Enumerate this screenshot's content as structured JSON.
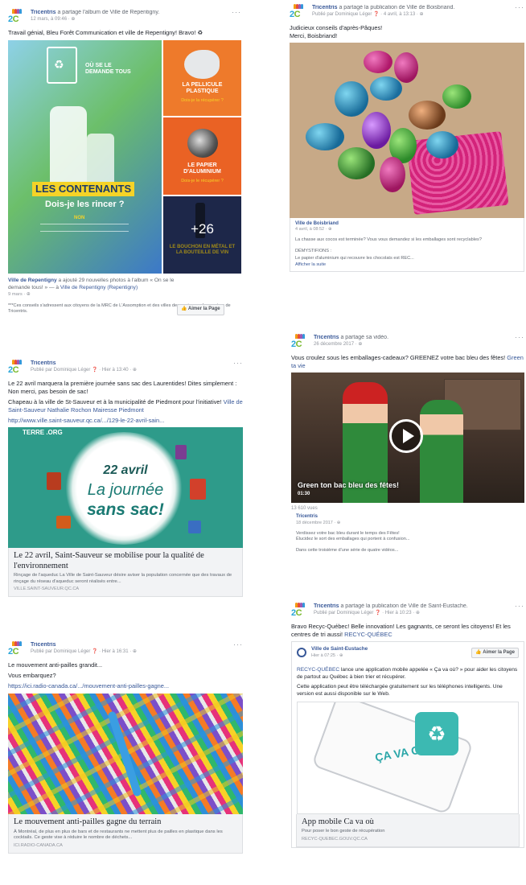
{
  "colors": {
    "link": "#385898",
    "green_bg": "#2e9b8a",
    "elf_green": "#2f8a3b"
  },
  "post1": {
    "author": "Tricentris",
    "action": "a partagé l'album de Ville de Repentigny.",
    "time": "12 mars, à 09:46 · ",
    "more": "···",
    "text": "Travail génial, Bleu Forêt Communication et ville de Repentigny! Bravo! ♻",
    "tile_main_top": "OÙ SE LE DEMANDE TOUS",
    "tile_main_title": "LES CONTENANTS",
    "tile_main_sub": "Dois-je les rincer ?",
    "tile_main_non": "NON",
    "tile_a_title": "LA PELLICULE PLASTIQUE",
    "tile_a_sub": "Dois-je la récupérer ?",
    "tile_b_title": "LE PAPIER D'ALUMINIUM",
    "tile_b_sub": "Dois-je le récupérer ?",
    "tile_c_title": "LE BOUCHON EN MÉTAL ET LA BOUTEILLE DE VIN",
    "plus": "+26",
    "footer_name": "Ville de Repentigny",
    "footer_text": " a ajouté 29 nouvelles photos à l'album « On se le demande tous! » — à ",
    "footer_loc": "Ville de Repentigny (Repentigny)",
    "footer_time": "9 mars · ",
    "like_page": "👍 Aimer la Page",
    "note": "***Ces conseils s'adressent aux citoyens de la MRC de L'Assomption et des villes desservies par les centres de Tricentris."
  },
  "post2": {
    "author": "Tricentris",
    "action": "a partagé la publication de Ville de Boisbriand.",
    "time": "Publié par Dominique Léger ❓ · 4 avril, à 13:13 · ",
    "more": "···",
    "text": "Judicieux conseils d'après-Pâques!\nMerci, Boisbriand!",
    "shared_name": "Ville de Boisbriand",
    "shared_time": "4 avril, à 08:52 · ",
    "shared_text": "La chasse aux cocos est terminée? Vous vous demandez si les emballages sont recyclables?",
    "shared_tag": "DÉMYSTIFIONS :",
    "shared_text2": "Le papier d'aluminium qui recouvre les chocolats est REC...",
    "shared_more": "Afficher la suite"
  },
  "post3": {
    "author": "Tricentris",
    "time": "Publié par Dominique Léger ❓ · Hier à 13:40 · ",
    "more": "···",
    "text1": "Le 22 avril marquera la première journée sans sac des Laurentides! Dites simplement : Non merci, pas besoin de sac!",
    "text2a": "Chapeau à la ville de St-Sauveur et à la municipalité de Piedmont pour l'initiative! ",
    "text2b": "Ville de Saint-Sauveur Nathalie Rochon Mairesse Piedmont",
    "url": "http://www.ville.saint-sauveur.qc.ca/.../129-le-22-avril-sain...",
    "img_brand": "TERRE .ORG",
    "img_date": "22 avril",
    "img_line1": "La journée",
    "img_line2": "sans sac!",
    "cap_title": "Le 22 avril, Saint-Sauveur se mobilise pour la qualité de l'environnement",
    "cap_desc": "Rinçage de l'aqueduc La Ville de Saint-Sauveur désire aviser la population concernée que des travaux de rinçage du réseau d'aqueduc seront réalisés entre...",
    "cap_src": "VILLE.SAINT-SAUVEUR.QC.CA"
  },
  "post4": {
    "author": "Tricentris",
    "action": "a partagé sa vidéo.",
    "time": "26 décembre 2017 · ",
    "more": "···",
    "text_a": "Vous croulez sous les emballages-cadeaux? GREENEZ votre bac bleu des fêtes! ",
    "text_b": "Green ta vie",
    "video_title": "Green ton bac bleu des fêtes!",
    "video_time": "01:30",
    "views": "13 610 vues",
    "shared_name": "Tricentris",
    "shared_time": "18 décembre 2017 · ",
    "shared_text": "Verdissez votre bac bleu durant le temps des Fêtes!\nÉlucidez le sort des emballages qui portent à confusion...",
    "shared_text2": "Dans cette troisième d'une série de quatre vidéos..."
  },
  "post5": {
    "author": "Tricentris",
    "time": "Publié par Dominique Léger ❓ · Hier à 16:31 · ",
    "more": "···",
    "text1": "Le mouvement anti-pailles grandit...",
    "text2": "Vous embarquez?",
    "url": "https://ici.radio-canada.ca/.../mouvement-anti-pailles-gagne...",
    "cap_title": "Le mouvement anti-pailles gagne du terrain",
    "cap_desc": "À Montréal, de plus en plus de bars et de restaurants ne mettent plus de pailles en plastique dans les cocktails. Ce geste vise à réduire le nombre de déchets...",
    "cap_src": "ICI.RADIO-CANADA.CA"
  },
  "post6": {
    "author": "Tricentris",
    "action": "a partagé la publication de Ville de Saint-Eustache.",
    "time": "Publié par Dominique Léger ❓ · Hier à 10:23 · ",
    "more": "···",
    "text_a": "Bravo Recyc-Québec! Belle innovation! Les gagnants, ce seront les citoyens! Et les centres de tri aussi! ",
    "text_b": "RECYC-QUÉBEC",
    "inner_name": "Ville de Saint-Eustache",
    "inner_time": "Hier à 07:25 · ",
    "like_page": "👍 Aimer la Page",
    "inner_text1a": "RECYC-QUÉBEC",
    "inner_text1b": " lance une application mobile appelée « Ça va où? » pour aider les citoyens de partout au Québec à bien trier et récupérer.",
    "inner_text2": "Cette application peut être téléchargée gratuitement sur les téléphones intelligents. Une version est aussi disponible sur le Web.",
    "app_text": "ÇA VA OÙ?",
    "cap_title": "App mobile Ca va où",
    "cap_desc": "Pour poser le bon geste de récupération",
    "cap_src": "RECYC-QUEBEC.GOUV.QC.CA"
  }
}
